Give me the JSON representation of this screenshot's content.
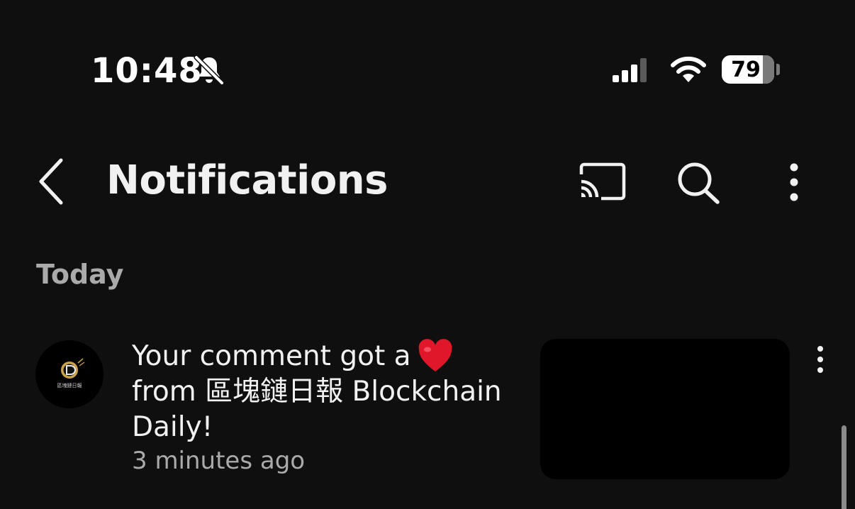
{
  "status_bar": {
    "time": "10:48",
    "battery_level": "79",
    "battery_fraction": 0.79,
    "icons": [
      "bell-slash-icon",
      "signal-icon",
      "wifi-icon",
      "battery-icon"
    ]
  },
  "header": {
    "title": "Notifications",
    "icons": [
      "back-arrow-icon",
      "cast-icon",
      "search-icon",
      "more-vert-icon"
    ]
  },
  "section": {
    "heading": "Today"
  },
  "notifications": [
    {
      "message_line1": "Your comment got a",
      "message_icon": "red-heart-icon",
      "message_line2": "from 區塊鏈日報 Blockchain",
      "message_line3": "Daily!",
      "time": "3 minutes ago",
      "avatar_text": "區塊鏈日報",
      "avatar_icon": "blockchain-daily-logo"
    }
  ],
  "colors": {
    "background": "#0f0f0f",
    "text_primary": "#f1f1f1",
    "text_secondary": "#aaaaaa",
    "heart": "#e0162b"
  }
}
